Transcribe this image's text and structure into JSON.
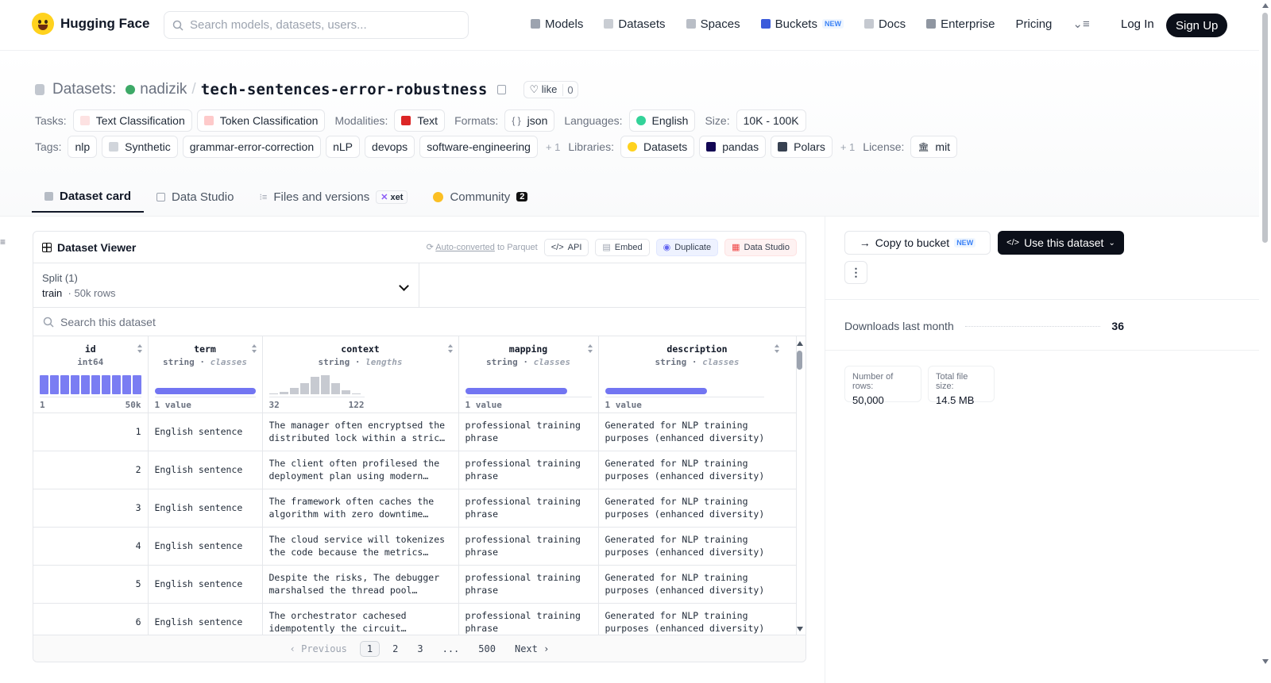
{
  "header": {
    "brand": "Hugging Face",
    "search_placeholder": "Search models, datasets, users...",
    "nav": [
      {
        "label": "Models",
        "icon": "cube-icon"
      },
      {
        "label": "Datasets",
        "icon": "database-icon"
      },
      {
        "label": "Spaces",
        "icon": "grid-icon"
      },
      {
        "label": "Buckets",
        "icon": "bucket-icon",
        "badge": "NEW"
      },
      {
        "label": "Docs",
        "icon": "book-icon"
      },
      {
        "label": "Enterprise",
        "icon": "enterprise-icon"
      },
      {
        "label": "Pricing"
      }
    ],
    "login": "Log In",
    "signup": "Sign Up"
  },
  "dataset": {
    "section_label": "Datasets:",
    "owner": "nadizik",
    "name": "tech-sentences-error-robustness",
    "like_label": "like",
    "like_count": "0",
    "tasks_label": "Tasks:",
    "tasks": [
      "Text Classification",
      "Token Classification"
    ],
    "modalities_label": "Modalities:",
    "modalities": [
      "Text"
    ],
    "formats_label": "Formats:",
    "formats": [
      "json"
    ],
    "languages_label": "Languages:",
    "languages": [
      "English"
    ],
    "size_label": "Size:",
    "size": "10K - 100K",
    "tags_label": "Tags:",
    "tags": [
      "nlp",
      "Synthetic",
      "grammar-error-correction",
      "nLP",
      "devops",
      "software-engineering"
    ],
    "tags_more": "+ 1",
    "libraries_label": "Libraries:",
    "libraries": [
      "Datasets",
      "pandas",
      "Polars"
    ],
    "libraries_more": "+ 1",
    "license_label": "License:",
    "license": "mit"
  },
  "tabs": [
    {
      "label": "Dataset card",
      "active": true
    },
    {
      "label": "Data Studio"
    },
    {
      "label": "Files and versions",
      "badge": "xet"
    },
    {
      "label": "Community",
      "badge": "2"
    }
  ],
  "viewer": {
    "title": "Dataset Viewer",
    "auto_converted": "Auto-converted",
    "to_parquet": "to Parquet",
    "api": "API",
    "embed": "Embed",
    "duplicate": "Duplicate",
    "data_studio": "Data Studio",
    "split_label": "Split (1)",
    "split_name": "train",
    "split_rows": "50k rows",
    "search_placeholder": "Search this dataset",
    "columns": [
      {
        "name": "id",
        "type": "int64",
        "kind": "",
        "min": "1",
        "max": "50k"
      },
      {
        "name": "term",
        "type": "string",
        "kind": "classes",
        "min": "1 value",
        "max": ""
      },
      {
        "name": "context",
        "type": "string",
        "kind": "lengths",
        "min": "32",
        "max": "122"
      },
      {
        "name": "mapping",
        "type": "string",
        "kind": "classes",
        "min": "1 value",
        "max": ""
      },
      {
        "name": "description",
        "type": "string",
        "kind": "classes",
        "min": "1 value",
        "max": ""
      }
    ],
    "rows": [
      {
        "id": "1",
        "term": "English sentence",
        "context": "The manager often encryptsed the distributed lock within a stric…",
        "mapping": "professional training phrase",
        "description": "Generated for NLP training purposes (enhanced diversity)"
      },
      {
        "id": "2",
        "term": "English sentence",
        "context": "The client often profilesed the deployment plan using modern…",
        "mapping": "professional training phrase",
        "description": "Generated for NLP training purposes (enhanced diversity)"
      },
      {
        "id": "3",
        "term": "English sentence",
        "context": "The framework often caches the algorithm with zero downtime…",
        "mapping": "professional training phrase",
        "description": "Generated for NLP training purposes (enhanced diversity)"
      },
      {
        "id": "4",
        "term": "English sentence",
        "context": "The cloud service will tokenizes the code because the metrics…",
        "mapping": "professional training phrase",
        "description": "Generated for NLP training purposes (enhanced diversity)"
      },
      {
        "id": "5",
        "term": "English sentence",
        "context": "Despite the risks, The debugger marshalsed the thread pool…",
        "mapping": "professional training phrase",
        "description": "Generated for NLP training purposes (enhanced diversity)"
      },
      {
        "id": "6",
        "term": "English sentence",
        "context": "The orchestrator cachesed idempotently the circuit…",
        "mapping": "professional training phrase",
        "description": "Generated for NLP training purposes (enhanced diversity)"
      }
    ],
    "pager": {
      "prev": "Previous",
      "pages": [
        "1",
        "2",
        "3",
        "...",
        "500"
      ],
      "current": "1",
      "next": "Next"
    }
  },
  "sidebar": {
    "copy_bucket": "Copy to bucket",
    "copy_badge": "NEW",
    "use_dataset": "Use this dataset",
    "downloads_label": "Downloads last month",
    "downloads": "36",
    "rows_label": "Number of rows:",
    "rows_value": "50,000",
    "size_label": "Total file size:",
    "size_value": "14.5 MB"
  },
  "colors": {
    "accent": "#6366f1",
    "dark": "#0b0f19",
    "green_dot": "#3da967",
    "hf_yellow": "#ffd21e"
  }
}
